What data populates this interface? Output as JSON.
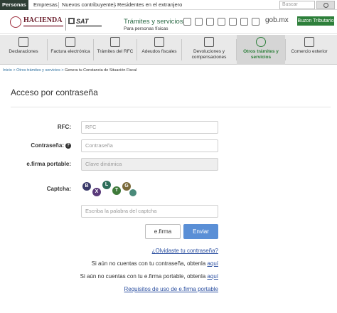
{
  "topnav": {
    "tabs": [
      "Personas",
      "Empresas",
      "Nuevos contribuyentes",
      "Residentes en el extranjero"
    ],
    "search_placeholder": "Buscar"
  },
  "header": {
    "hacienda": "HACIENDA",
    "sat": "SAT",
    "title": "Trámites y servicios",
    "subtitle": "Para personas físicas",
    "gobmx": "gob.mx",
    "buzon": "Buzon Tributario"
  },
  "menu": [
    {
      "label": "Declaraciones",
      "icon": "declaraciones-icon"
    },
    {
      "label": "Factura electrónica",
      "icon": "factura-icon"
    },
    {
      "label": "Trámites del RFC",
      "icon": "rfc-icon"
    },
    {
      "label": "Adeudos fiscales",
      "icon": "adeudos-icon"
    },
    {
      "label": "Devoluciones y compensaciones",
      "icon": "devoluciones-icon"
    },
    {
      "label": "Otros trámites y servicios",
      "icon": "otros-tramites-icon"
    },
    {
      "label": "Comercio exterior",
      "icon": "comercio-exterior-icon"
    }
  ],
  "breadcrumb": {
    "inicio": "Inicio",
    "otros": "Otros trámites y servicios",
    "current": "Genera tu Constancia de Situación Fiscal"
  },
  "form": {
    "title": "Acceso por contraseña",
    "rfc_label": "RFC:",
    "rfc_placeholder": "RFC",
    "password_label": "Contraseña:",
    "password_placeholder": "Contraseña",
    "efirma_label": "e.firma portable:",
    "efirma_placeholder": "Clave dinámica",
    "captcha_label": "Captcha:",
    "captcha_placeholder": "Escriba la palabra del captcha",
    "btn_efirma": "e.firma",
    "btn_enviar": "Enviar"
  },
  "links": {
    "forgot": "¿Olvidaste tu contraseña?",
    "no_password": "Si aún no cuentas con tu contraseña, obtenla",
    "no_efirma": "Si aún no cuentas con tu e.firma portable, obtenla",
    "aqui": "aquí",
    "requisitos": "Requisitos de uso de e.firma portable"
  },
  "colors": {
    "active_tab": "#2e3e34",
    "accent_green": "#2d7f3a",
    "enviar_blue": "#5a8fd6",
    "link_blue": "#2b4fa0"
  }
}
